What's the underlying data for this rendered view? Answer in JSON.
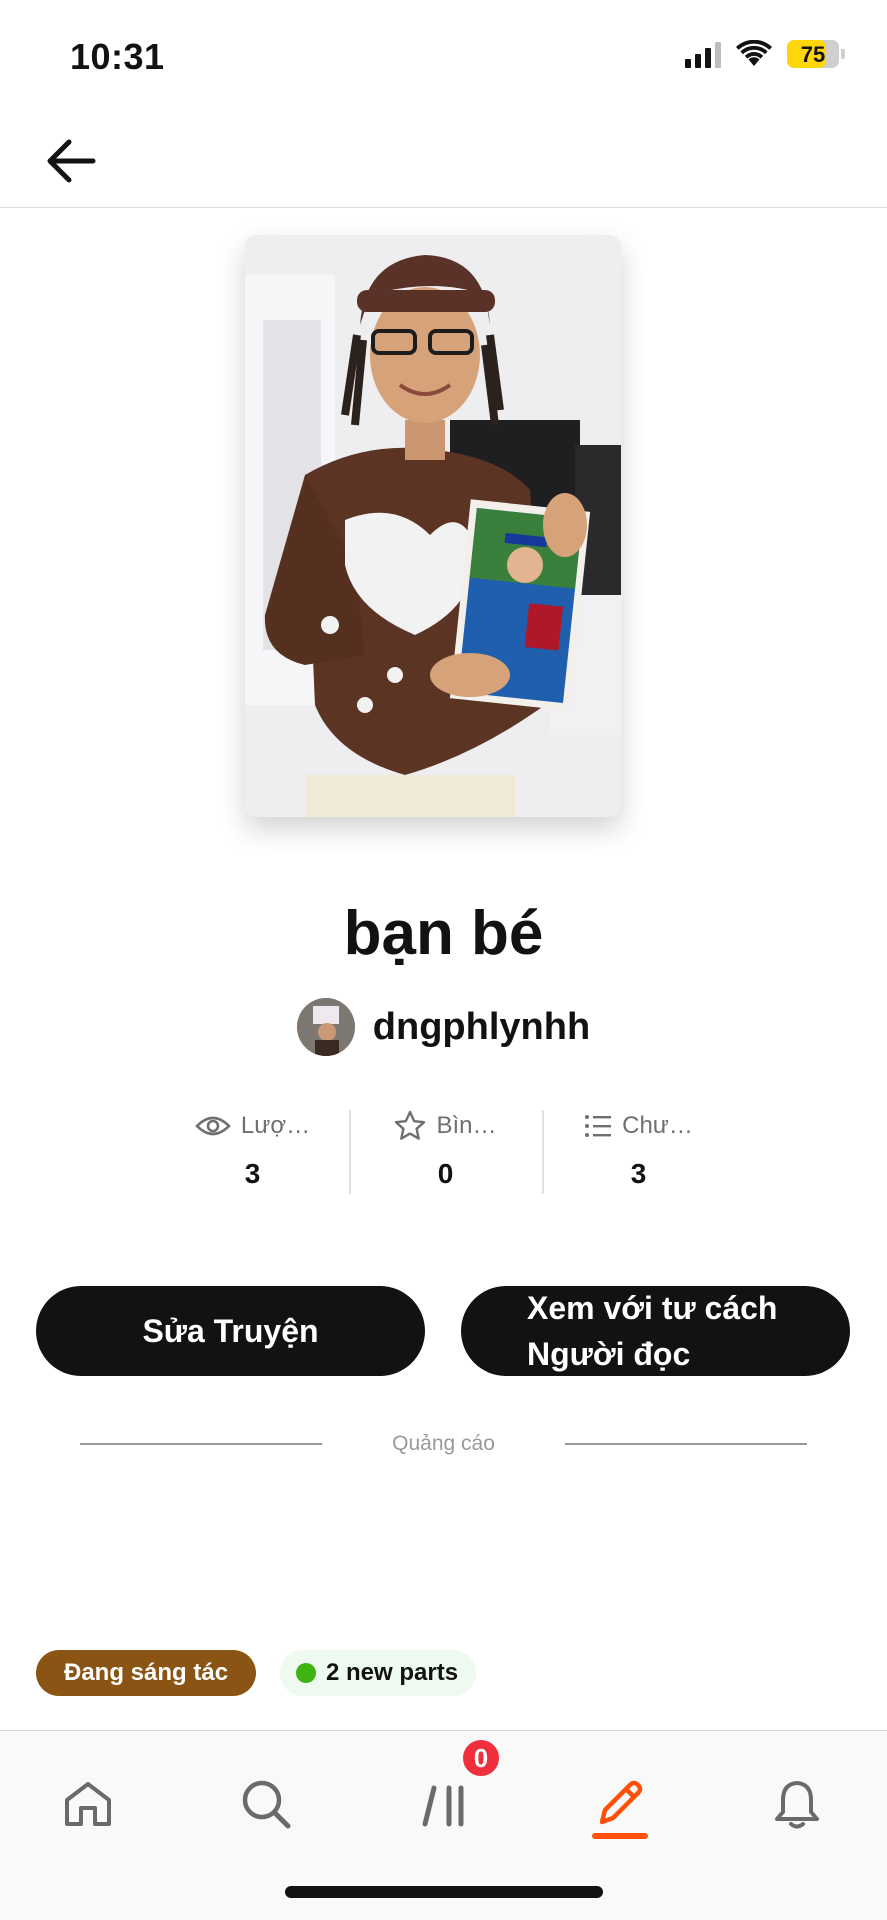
{
  "status_bar": {
    "time": "10:31",
    "battery_level": "75",
    "icons": [
      "signal-icon",
      "wifi-icon",
      "battery-icon"
    ]
  },
  "header": {
    "back_icon": "arrow-left-icon"
  },
  "story": {
    "title": "bạn bé",
    "author": "dngphlynhh"
  },
  "stats": [
    {
      "icon": "eye-icon",
      "label": "Lượ…",
      "value": "3"
    },
    {
      "icon": "star-icon",
      "label": "Bìn…",
      "value": "0"
    },
    {
      "icon": "list-icon",
      "label": "Chư…",
      "value": "3"
    }
  ],
  "actions": {
    "edit_label": "Sửa Truyện",
    "read_label_line1": "Xem với tư cách",
    "read_label_line2": "Người đọc"
  },
  "ad": {
    "label": "Quảng cáo"
  },
  "tags": {
    "status": "Đang sáng tác",
    "new_parts": "2 new parts"
  },
  "bottom_nav": {
    "items": [
      "home-icon",
      "search-icon",
      "library-icon",
      "pencil-icon",
      "bell-icon"
    ],
    "active": "pencil-icon",
    "library_badge": "0"
  },
  "colors": {
    "accent": "#ff500a",
    "status_tag": "#8a5514",
    "new_parts_dot": "#3fb311",
    "badge": "#ef2f3c",
    "button": "#121212"
  }
}
